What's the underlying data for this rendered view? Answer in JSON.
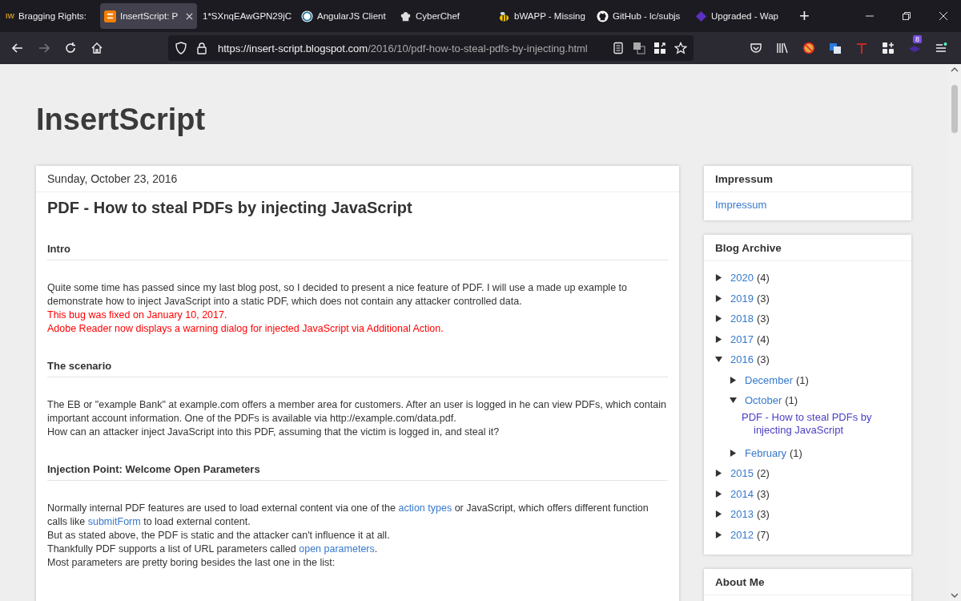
{
  "tabs": [
    {
      "title": "Bragging Rights:",
      "icon_text": "IW",
      "selected": false
    },
    {
      "title": "InsertScript: P",
      "selected": true
    },
    {
      "title": "1*SXnqEAwGPN29jC",
      "selected": false
    },
    {
      "title": "AngularJS Client",
      "selected": false
    },
    {
      "title": "CyberChef",
      "selected": false
    },
    {
      "title": "bWAPP - Missing",
      "selected": false
    },
    {
      "title": "GitHub - lc/subjs",
      "selected": false
    },
    {
      "title": "Upgraded - Wap",
      "selected": false
    }
  ],
  "new_tab": "+",
  "toolbar": {
    "url_host": "https://insert-script.blogspot.com",
    "url_path": "/2016/10/pdf-how-to-steal-pdfs-by-injecting.html",
    "badge": "8",
    "forward_disabled": true
  },
  "blog": {
    "title": "InsertScript"
  },
  "post": {
    "date": "Sunday, October 23, 2016",
    "title": "PDF - How to steal PDFs by injecting JavaScript",
    "sections": [
      {
        "heading": "Intro",
        "paragraphs": [
          {
            "kind": "normal",
            "parts": [
              {
                "kind": "text",
                "text": "Quite some time has passed since my last blog post, so I decided to present a nice feature of PDF. I will use a made up example to demonstrate how to inject JavaScript into a static PDF, which does not contain any attacker controlled data."
              }
            ]
          },
          {
            "kind": "alert",
            "parts": [
              {
                "kind": "text",
                "text": "This bug was fixed on January 10, 2017."
              }
            ]
          },
          {
            "kind": "alert",
            "parts": [
              {
                "kind": "text",
                "text": "Adobe Reader now displays a warning dialog for injected JavaScript via Additional Action."
              }
            ]
          }
        ]
      },
      {
        "heading": "The scenario",
        "paragraphs": [
          {
            "kind": "normal",
            "parts": [
              {
                "kind": "text",
                "text": "The EB or \"example Bank\" at example.com offers a member area for customers. After an user is logged in he can view PDFs, which contain important account information. One of the PDFs is available via http://example.com/data.pdf."
              }
            ]
          },
          {
            "kind": "normal",
            "parts": [
              {
                "kind": "text",
                "text": "How can an attacker inject JavaScript into this PDF, assuming that the victim is logged in, and steal it?"
              }
            ]
          }
        ]
      },
      {
        "heading": "Injection Point: Welcome Open Parameters",
        "paragraphs": [
          {
            "kind": "normal",
            "parts": [
              {
                "kind": "text",
                "text": "Normally internal PDF features are used to load external content via one of the "
              },
              {
                "kind": "link",
                "text": "action types"
              },
              {
                "kind": "text",
                "text": " or JavaScript, which offers different function calls like "
              },
              {
                "kind": "link",
                "text": "submitForm"
              },
              {
                "kind": "text",
                "text": " to load external content."
              }
            ]
          },
          {
            "kind": "normal",
            "parts": [
              {
                "kind": "text",
                "text": "But as stated above, the PDF is static and the attacker can't influence it at all."
              }
            ]
          },
          {
            "kind": "normal",
            "parts": [
              {
                "kind": "text",
                "text": "Thankfully PDF supports a list of URL parameters called "
              },
              {
                "kind": "link",
                "text": "open parameters"
              },
              {
                "kind": "text",
                "text": "."
              }
            ]
          },
          {
            "kind": "normal",
            "parts": [
              {
                "kind": "text",
                "text": "Most parameters are pretty boring besides the last one in the list:"
              }
            ]
          }
        ]
      }
    ]
  },
  "sidebar": [
    {
      "title": "Impressum",
      "kind": "links",
      "links": [
        "Impressum"
      ]
    },
    {
      "title": "Blog Archive",
      "kind": "archive",
      "items": [
        {
          "label": "2020",
          "count": "(4)",
          "expanded": false
        },
        {
          "label": "2019",
          "count": "(3)",
          "expanded": false
        },
        {
          "label": "2018",
          "count": "(3)",
          "expanded": false
        },
        {
          "label": "2017",
          "count": "(4)",
          "expanded": false
        },
        {
          "label": "2016",
          "count": "(3)",
          "expanded": true,
          "children": [
            {
              "label": "December",
              "count": "(1)",
              "expanded": false
            },
            {
              "label": "October",
              "count": "(1)",
              "expanded": true,
              "posts": [
                "PDF - How to steal PDFs by injecting JavaScript"
              ]
            },
            {
              "label": "February",
              "count": "(1)",
              "expanded": false
            }
          ]
        },
        {
          "label": "2015",
          "count": "(2)",
          "expanded": false
        },
        {
          "label": "2014",
          "count": "(3)",
          "expanded": false
        },
        {
          "label": "2013",
          "count": "(3)",
          "expanded": false
        },
        {
          "label": "2012",
          "count": "(7)",
          "expanded": false
        }
      ]
    },
    {
      "title": "About Me",
      "kind": "about"
    }
  ]
}
